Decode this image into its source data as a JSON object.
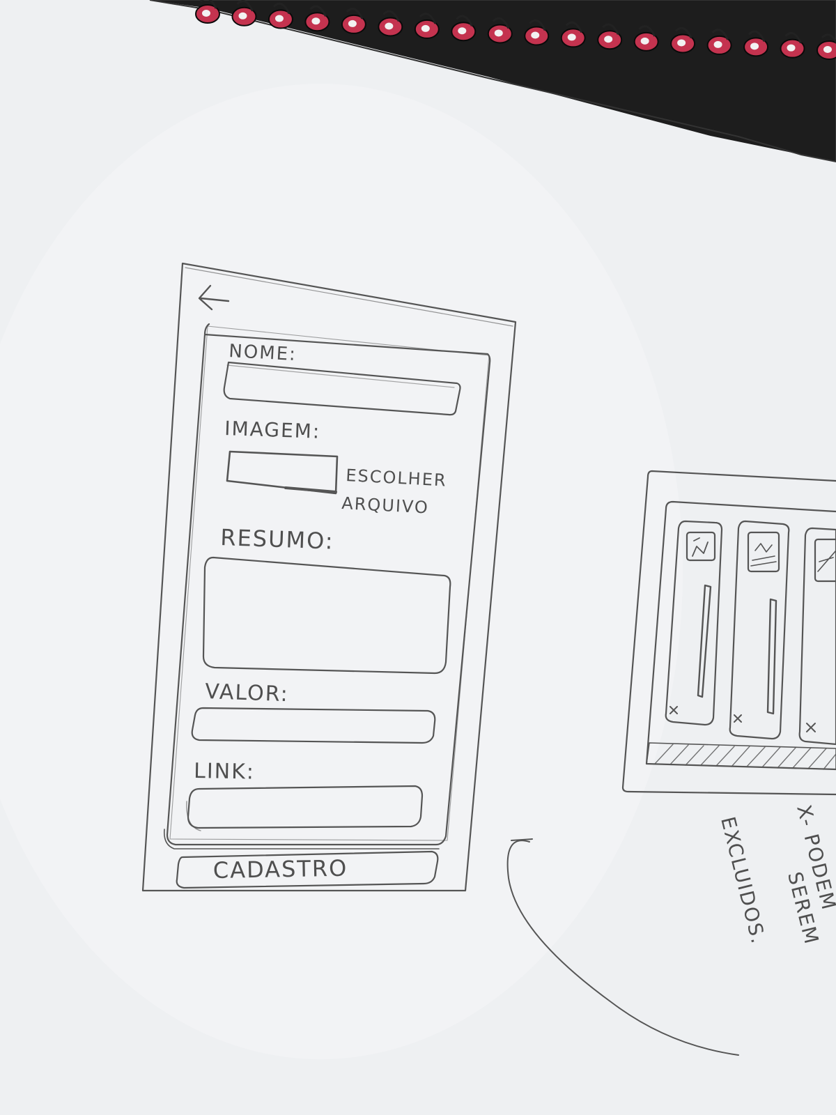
{
  "colors": {
    "paper": "#eef0f2",
    "pencil": "#555555",
    "binding_ring": "#c4334f",
    "cover": "#1e1e1e"
  },
  "form_mockup": {
    "back_icon": "arrow-left-icon",
    "fields": {
      "nome_label": "NOME:",
      "imagem_label": "IMAGEM:",
      "choose_file_line1": "ESCOLHER",
      "choose_file_line2": "ARQUIVO",
      "resumo_label": "RESUMO:",
      "valor_label": "VALOR:",
      "link_label": "LINK:"
    },
    "submit_label": "CADASTRO"
  },
  "list_mockup": {
    "card_count": 3,
    "card_icon": "image-thumbnail-icon",
    "delete_marker": "X"
  },
  "annotation": {
    "line1": "X- PODEM",
    "line2": "SEREM",
    "line3": "EXCLUIDOS."
  }
}
